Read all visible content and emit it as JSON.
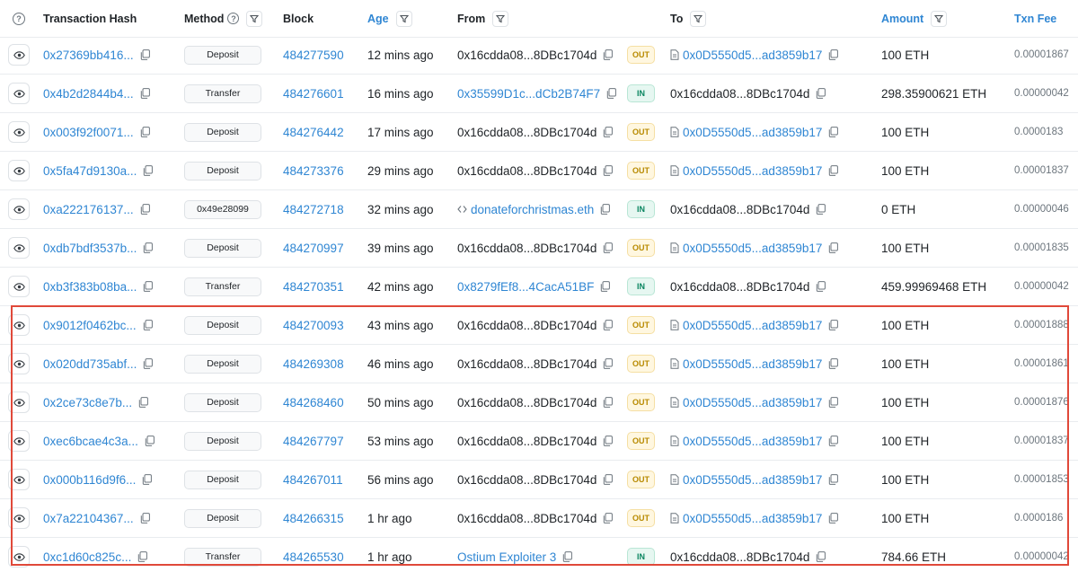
{
  "header": {
    "help_icon": "question-circle-icon",
    "tx_hash": "Transaction Hash",
    "method": "Method",
    "block": "Block",
    "age": "Age",
    "from": "From",
    "to": "To",
    "amount": "Amount",
    "txn_fee": "Txn Fee"
  },
  "colors": {
    "link": "#2f86d3",
    "highlight": "#e0493a",
    "out_badge": "#fff7e0",
    "in_badge": "#e6f7f1"
  },
  "rows": [
    {
      "hash": "0x27369bb416...",
      "method": "Deposit",
      "block": "484277590",
      "age": "12 mins ago",
      "from": "0x16cdda08...8DBc1704d",
      "from_link": false,
      "from_icon": "",
      "dir": "OUT",
      "to": "0x0D5550d5...ad3859b17",
      "to_link": true,
      "to_icon": "doc",
      "amount": "100 ETH",
      "fee": "0.00001867"
    },
    {
      "hash": "0x4b2d2844b4...",
      "method": "Transfer",
      "block": "484276601",
      "age": "16 mins ago",
      "from": "0x35599D1c...dCb2B74F7",
      "from_link": true,
      "from_icon": "",
      "dir": "IN",
      "to": "0x16cdda08...8DBc1704d",
      "to_link": false,
      "to_icon": "",
      "amount": "298.35900621 ETH",
      "fee": "0.00000042"
    },
    {
      "hash": "0x003f92f0071...",
      "method": "Deposit",
      "block": "484276442",
      "age": "17 mins ago",
      "from": "0x16cdda08...8DBc1704d",
      "from_link": false,
      "from_icon": "",
      "dir": "OUT",
      "to": "0x0D5550d5...ad3859b17",
      "to_link": true,
      "to_icon": "doc",
      "amount": "100 ETH",
      "fee": "0.0000183"
    },
    {
      "hash": "0x5fa47d9130a...",
      "method": "Deposit",
      "block": "484273376",
      "age": "29 mins ago",
      "from": "0x16cdda08...8DBc1704d",
      "from_link": false,
      "from_icon": "",
      "dir": "OUT",
      "to": "0x0D5550d5...ad3859b17",
      "to_link": true,
      "to_icon": "doc",
      "amount": "100 ETH",
      "fee": "0.00001837"
    },
    {
      "hash": "0xa222176137...",
      "method": "0x49e28099",
      "block": "484272718",
      "age": "32 mins ago",
      "from": "donateforchristmas.eth",
      "from_link": true,
      "from_icon": "code",
      "dir": "IN",
      "to": "0x16cdda08...8DBc1704d",
      "to_link": false,
      "to_icon": "",
      "amount": "0 ETH",
      "fee": "0.00000046"
    },
    {
      "hash": "0xdb7bdf3537b...",
      "method": "Deposit",
      "block": "484270997",
      "age": "39 mins ago",
      "from": "0x16cdda08...8DBc1704d",
      "from_link": false,
      "from_icon": "",
      "dir": "OUT",
      "to": "0x0D5550d5...ad3859b17",
      "to_link": true,
      "to_icon": "doc",
      "amount": "100 ETH",
      "fee": "0.00001835"
    },
    {
      "hash": "0xb3f383b08ba...",
      "method": "Transfer",
      "block": "484270351",
      "age": "42 mins ago",
      "from": "0x8279fEf8...4CacA51BF",
      "from_link": true,
      "from_icon": "",
      "dir": "IN",
      "to": "0x16cdda08...8DBc1704d",
      "to_link": false,
      "to_icon": "",
      "amount": "459.99969468 ETH",
      "fee": "0.00000042"
    },
    {
      "hash": "0x9012f0462bc...",
      "method": "Deposit",
      "block": "484270093",
      "age": "43 mins ago",
      "from": "0x16cdda08...8DBc1704d",
      "from_link": false,
      "from_icon": "",
      "dir": "OUT",
      "to": "0x0D5550d5...ad3859b17",
      "to_link": true,
      "to_icon": "doc",
      "amount": "100 ETH",
      "fee": "0.00001888"
    },
    {
      "hash": "0x020dd735abf...",
      "method": "Deposit",
      "block": "484269308",
      "age": "46 mins ago",
      "from": "0x16cdda08...8DBc1704d",
      "from_link": false,
      "from_icon": "",
      "dir": "OUT",
      "to": "0x0D5550d5...ad3859b17",
      "to_link": true,
      "to_icon": "doc",
      "amount": "100 ETH",
      "fee": "0.00001861"
    },
    {
      "hash": "0x2ce73c8e7b...",
      "method": "Deposit",
      "block": "484268460",
      "age": "50 mins ago",
      "from": "0x16cdda08...8DBc1704d",
      "from_link": false,
      "from_icon": "",
      "dir": "OUT",
      "to": "0x0D5550d5...ad3859b17",
      "to_link": true,
      "to_icon": "doc",
      "amount": "100 ETH",
      "fee": "0.00001876"
    },
    {
      "hash": "0xec6bcae4c3a...",
      "method": "Deposit",
      "block": "484267797",
      "age": "53 mins ago",
      "from": "0x16cdda08...8DBc1704d",
      "from_link": false,
      "from_icon": "",
      "dir": "OUT",
      "to": "0x0D5550d5...ad3859b17",
      "to_link": true,
      "to_icon": "doc",
      "amount": "100 ETH",
      "fee": "0.00001837"
    },
    {
      "hash": "0x000b116d9f6...",
      "method": "Deposit",
      "block": "484267011",
      "age": "56 mins ago",
      "from": "0x16cdda08...8DBc1704d",
      "from_link": false,
      "from_icon": "",
      "dir": "OUT",
      "to": "0x0D5550d5...ad3859b17",
      "to_link": true,
      "to_icon": "doc",
      "amount": "100 ETH",
      "fee": "0.00001853"
    },
    {
      "hash": "0x7a22104367...",
      "method": "Deposit",
      "block": "484266315",
      "age": "1 hr ago",
      "from": "0x16cdda08...8DBc1704d",
      "from_link": false,
      "from_icon": "",
      "dir": "OUT",
      "to": "0x0D5550d5...ad3859b17",
      "to_link": true,
      "to_icon": "doc",
      "amount": "100 ETH",
      "fee": "0.0000186"
    },
    {
      "hash": "0xc1d60c825c...",
      "method": "Transfer",
      "block": "484265530",
      "age": "1 hr ago",
      "from": "Ostium Exploiter 3",
      "from_link": true,
      "from_icon": "",
      "dir": "IN",
      "to": "0x16cdda08...8DBc1704d",
      "to_link": false,
      "to_icon": "",
      "amount": "784.66 ETH",
      "fee": "0.00000042"
    }
  ]
}
